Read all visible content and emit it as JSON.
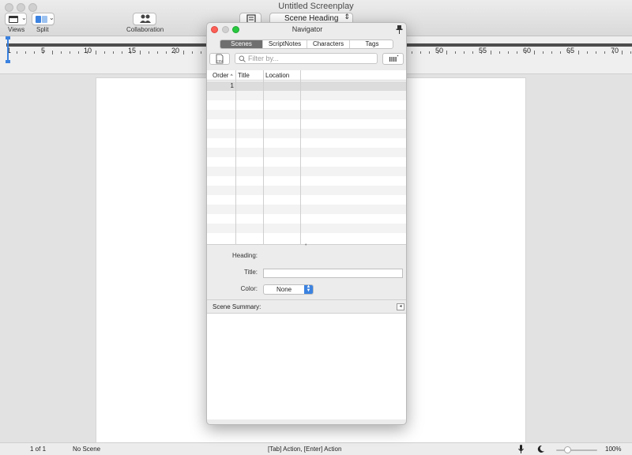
{
  "window": {
    "title": "Untitled Screenplay"
  },
  "toolbar": {
    "views_label": "Views",
    "split_label": "Split",
    "collaboration_label": "Collaboration",
    "element_selector": "Scene Heading"
  },
  "ruler": {
    "labels": [
      "5",
      "10",
      "15",
      "20",
      "50",
      "55",
      "60",
      "65",
      "70"
    ]
  },
  "navigator": {
    "title": "Navigator",
    "tabs": [
      "Scenes",
      "ScriptNotes",
      "Characters",
      "Tags"
    ],
    "active_tab": "Scenes",
    "export_label": "CSV",
    "filter_placeholder": "Filter by...",
    "columns": [
      "Order",
      "Title",
      "Location"
    ],
    "rows": [
      {
        "order": "1",
        "title": "",
        "location": ""
      }
    ],
    "heading_label": "Heading:",
    "title_label": "Title:",
    "color_label": "Color:",
    "color_value": "None",
    "summary_label": "Scene Summary:"
  },
  "statusbar": {
    "page_count": "1 of 1",
    "scene": "No Scene",
    "hint": "[Tab]  Action,  [Enter] Action",
    "zoom": "100%"
  },
  "colors": {
    "accent": "#3b82e0",
    "close": "#fc5f57",
    "minimize": "#fdbc2e",
    "zoom": "#28c840"
  }
}
